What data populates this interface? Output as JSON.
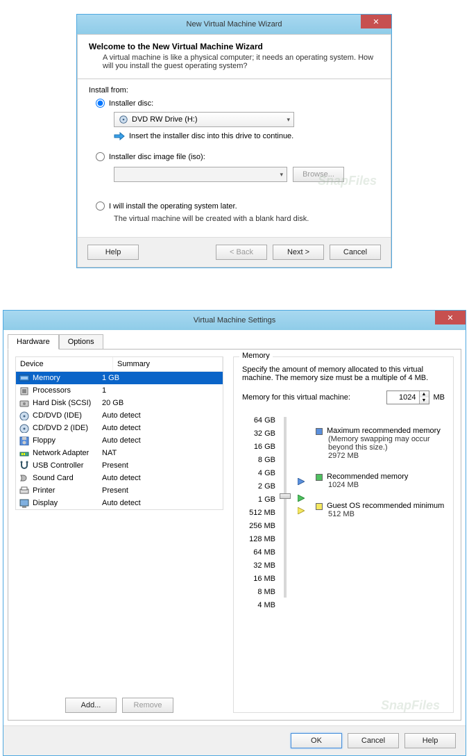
{
  "wizard": {
    "title": "New Virtual Machine Wizard",
    "heading": "Welcome to the New Virtual Machine Wizard",
    "intro": "A virtual machine is like a physical computer; it needs an operating system. How will you install the guest operating system?",
    "install_from": "Install from:",
    "opt_disc": "Installer disc:",
    "drive_label": "DVD RW Drive (H:)",
    "insert_hint": "Insert the installer disc into this drive to continue.",
    "opt_iso": "Installer disc image file (iso):",
    "browse": "Browse...",
    "opt_later": "I will install the operating system later.",
    "later_note": "The virtual machine will be created with a blank hard disk.",
    "help": "Help",
    "back": "< Back",
    "next": "Next >",
    "cancel": "Cancel"
  },
  "settings": {
    "title": "Virtual Machine Settings",
    "tab_hardware": "Hardware",
    "tab_options": "Options",
    "col_device": "Device",
    "col_summary": "Summary",
    "devices": [
      {
        "name": "Memory",
        "summary": "1 GB",
        "selected": true
      },
      {
        "name": "Processors",
        "summary": "1"
      },
      {
        "name": "Hard Disk (SCSI)",
        "summary": "20 GB"
      },
      {
        "name": "CD/DVD (IDE)",
        "summary": "Auto detect"
      },
      {
        "name": "CD/DVD 2 (IDE)",
        "summary": "Auto detect"
      },
      {
        "name": "Floppy",
        "summary": "Auto detect"
      },
      {
        "name": "Network Adapter",
        "summary": "NAT"
      },
      {
        "name": "USB Controller",
        "summary": "Present"
      },
      {
        "name": "Sound Card",
        "summary": "Auto detect"
      },
      {
        "name": "Printer",
        "summary": "Present"
      },
      {
        "name": "Display",
        "summary": "Auto detect"
      }
    ],
    "add": "Add...",
    "remove": "Remove",
    "memory": {
      "group": "Memory",
      "desc": "Specify the amount of memory allocated to this virtual machine. The memory size must be a multiple of 4 MB.",
      "label": "Memory for this virtual machine:",
      "value": "1024",
      "unit": "MB",
      "ticks": [
        "64 GB",
        "32 GB",
        "16 GB",
        "8 GB",
        "4 GB",
        "2 GB",
        "1 GB",
        "512 MB",
        "256 MB",
        "128 MB",
        "64 MB",
        "32 MB",
        "16 MB",
        "8 MB",
        "4 MB"
      ],
      "max_rec_label": "Maximum recommended memory",
      "max_rec_note": "(Memory swapping may occur beyond this size.)",
      "max_rec_val": "2972 MB",
      "rec_label": "Recommended memory",
      "rec_val": "1024 MB",
      "min_label": "Guest OS recommended minimum",
      "min_val": "512 MB"
    },
    "ok": "OK",
    "cancel": "Cancel",
    "help": "Help"
  },
  "watermark": "SnapFiles"
}
